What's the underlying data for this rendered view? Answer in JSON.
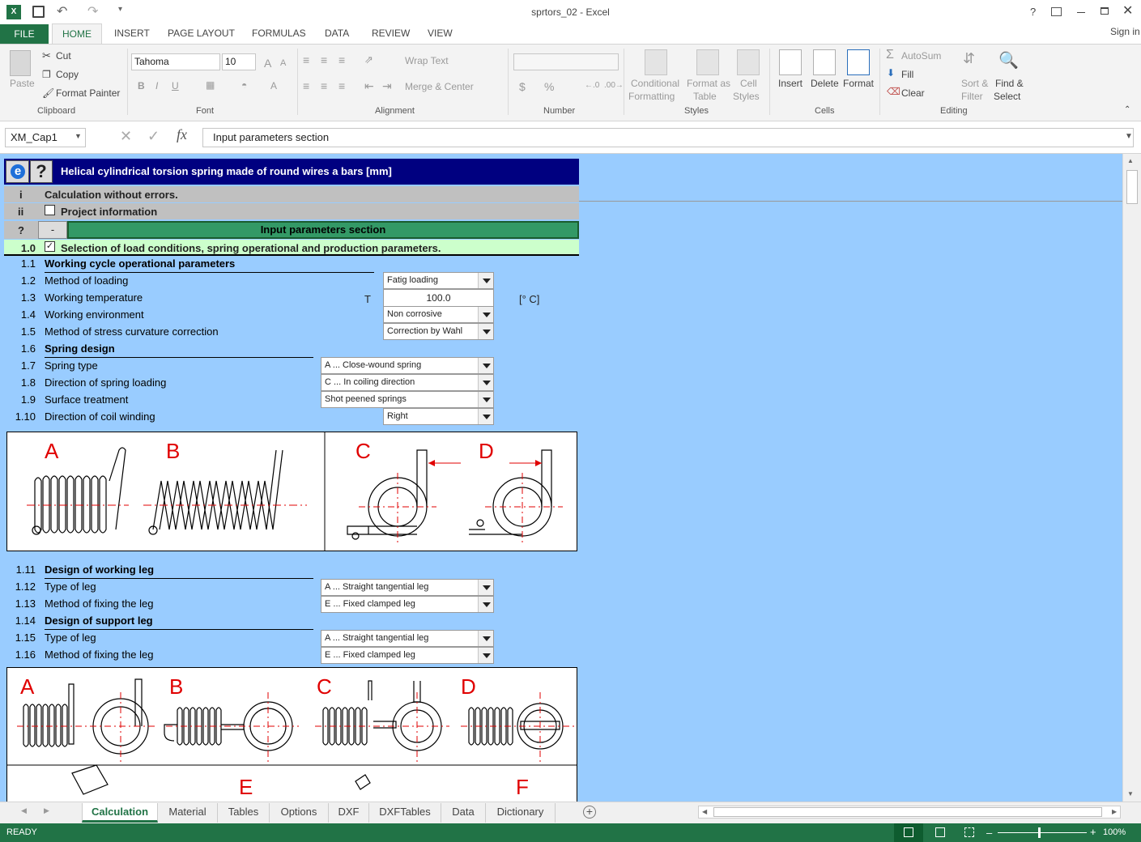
{
  "window": {
    "title": "sprtors_02 - Excel",
    "signin": "Sign in",
    "help": "?"
  },
  "ribbon_tabs": [
    "FILE",
    "HOME",
    "INSERT",
    "PAGE LAYOUT",
    "FORMULAS",
    "DATA",
    "REVIEW",
    "VIEW"
  ],
  "clipboard": {
    "paste": "Paste",
    "cut": "Cut",
    "copy": "Copy",
    "format_painter": "Format Painter",
    "group": "Clipboard"
  },
  "font": {
    "name": "Tahoma",
    "size": "10",
    "group": "Font",
    "bold": "B",
    "italic": "I",
    "underline": "U",
    "grow": "A",
    "shrink": "A"
  },
  "alignment": {
    "wrap_text": "Wrap Text",
    "merge_center": "Merge & Center",
    "group": "Alignment"
  },
  "number": {
    "group": "Number",
    "currency": "$",
    "percent": "%"
  },
  "styles": {
    "conditional": "Conditional",
    "formatting": "Formatting",
    "format_as": "Format as",
    "table": "Table",
    "cell": "Cell",
    "cell_styles": "Styles",
    "group": "Styles"
  },
  "cells": {
    "insert": "Insert",
    "delete": "Delete",
    "format": "Format",
    "group": "Cells"
  },
  "editing": {
    "autosum": "AutoSum",
    "fill": "Fill",
    "clear": "Clear",
    "sort": "Sort &",
    "filter": "Filter",
    "find": "Find &",
    "select": "Select",
    "group": "Editing"
  },
  "formula_bar": {
    "name_box": "XM_Cap1",
    "fx": "fx",
    "content": "Input parameters section"
  },
  "sheet": {
    "header_title": "Helical cylindrical torsion spring made of round wires a bars [mm]",
    "status_i": "i",
    "status_text": "Calculation without errors.",
    "project_num": "ii",
    "project_text": "Project information",
    "section_q": "?",
    "section_btn": "-",
    "section_title": "Input parameters section",
    "sel_num": "1.0",
    "sel_text": "Selection of load conditions, spring operational and production parameters.",
    "rows": [
      {
        "num": "1.1",
        "label": "Working cycle operational parameters"
      },
      {
        "num": "1.2",
        "label": "Method of loading",
        "value": "Fatig loading"
      },
      {
        "num": "1.3",
        "label": "Working temperature",
        "symbol": "T",
        "value": "100.0",
        "unit": "[° C]"
      },
      {
        "num": "1.4",
        "label": "Working environment",
        "value": "Non corrosive"
      },
      {
        "num": "1.5",
        "label": "Method of stress curvature correction",
        "value": "Correction by Wahl"
      },
      {
        "num": "1.6",
        "label": "Spring design"
      },
      {
        "num": "1.7",
        "label": "Spring type",
        "value": "A ... Close-wound spring"
      },
      {
        "num": "1.8",
        "label": "Direction of spring loading",
        "value": "C ... In coiling direction"
      },
      {
        "num": "1.9",
        "label": "Surface treatment",
        "value": "Shot peened springs"
      },
      {
        "num": "1.10",
        "label": "Direction of coil winding",
        "value": "Right"
      },
      {
        "num": "1.11",
        "label": "Design of working leg"
      },
      {
        "num": "1.12",
        "label": "Type of leg",
        "value": "A ... Straight tangential leg"
      },
      {
        "num": "1.13",
        "label": "Method of fixing the leg",
        "value": "E ... Fixed clamped leg"
      },
      {
        "num": "1.14",
        "label": "Design of support leg"
      },
      {
        "num": "1.15",
        "label": "Type of leg",
        "value": "A ... Straight tangential leg"
      },
      {
        "num": "1.16",
        "label": "Method of fixing the leg",
        "value": "E ... Fixed clamped leg"
      }
    ],
    "fig1_letters": [
      "A",
      "B",
      "C",
      "D"
    ],
    "fig2_letters": [
      "A",
      "B",
      "C",
      "D",
      "E",
      "F"
    ]
  },
  "sheet_tabs": [
    "Calculation",
    "Material",
    "Tables",
    "Options",
    "DXF",
    "DXFTables",
    "Data",
    "Dictionary"
  ],
  "status": {
    "ready": "READY",
    "zoom": "100%"
  },
  "colors": {
    "excel_green": "#217346",
    "sheet_bg": "#99ccff",
    "header_navy": "#000080",
    "section_green": "#339966",
    "light_green": "#ccffcc",
    "red_drawing": "#e00000"
  }
}
